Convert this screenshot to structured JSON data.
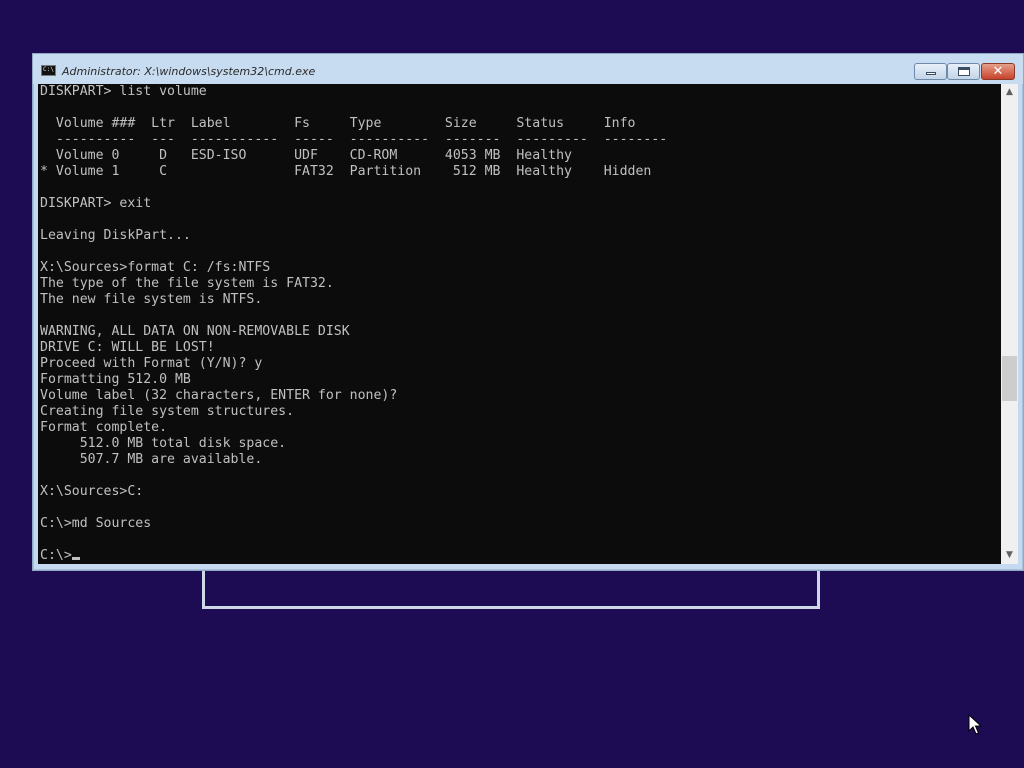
{
  "window": {
    "title": "Administrator: X:\\windows\\system32\\cmd.exe",
    "icon_label": "C:\\",
    "close_glyph": "✕"
  },
  "console": {
    "lines": [
      "DISKPART> list volume",
      "",
      "  Volume ###  Ltr  Label        Fs     Type        Size     Status     Info",
      "  ----------  ---  -----------  -----  ----------  -------  ---------  --------",
      "  Volume 0     D   ESD-ISO      UDF    CD-ROM      4053 MB  Healthy",
      "* Volume 1     C                FAT32  Partition    512 MB  Healthy    Hidden",
      "",
      "DISKPART> exit",
      "",
      "Leaving DiskPart...",
      "",
      "X:\\Sources>format C: /fs:NTFS",
      "The type of the file system is FAT32.",
      "The new file system is NTFS.",
      "",
      "WARNING, ALL DATA ON NON-REMOVABLE DISK",
      "DRIVE C: WILL BE LOST!",
      "Proceed with Format (Y/N)? y",
      "Formatting 512.0 MB",
      "Volume label (32 characters, ENTER for none)?",
      "Creating file system structures.",
      "Format complete.",
      "     512.0 MB total disk space.",
      "     507.7 MB are available.",
      "",
      "X:\\Sources>C:",
      "",
      "C:\\>md Sources",
      "",
      "C:\\>"
    ]
  },
  "scrollbar": {
    "up_glyph": "▲",
    "down_glyph": "▼"
  },
  "colors": {
    "desktop_background": "#1d0b54",
    "console_background": "#0c0c0c",
    "console_text": "#c0c0c0",
    "title_bar": "#c8dcf1",
    "close_button": "#c7432c"
  },
  "icons": {
    "app": "cmd-icon",
    "minimize": "minimize-icon",
    "maximize": "restore-icon",
    "close": "close-icon",
    "pointer": "mouse-pointer-icon"
  }
}
